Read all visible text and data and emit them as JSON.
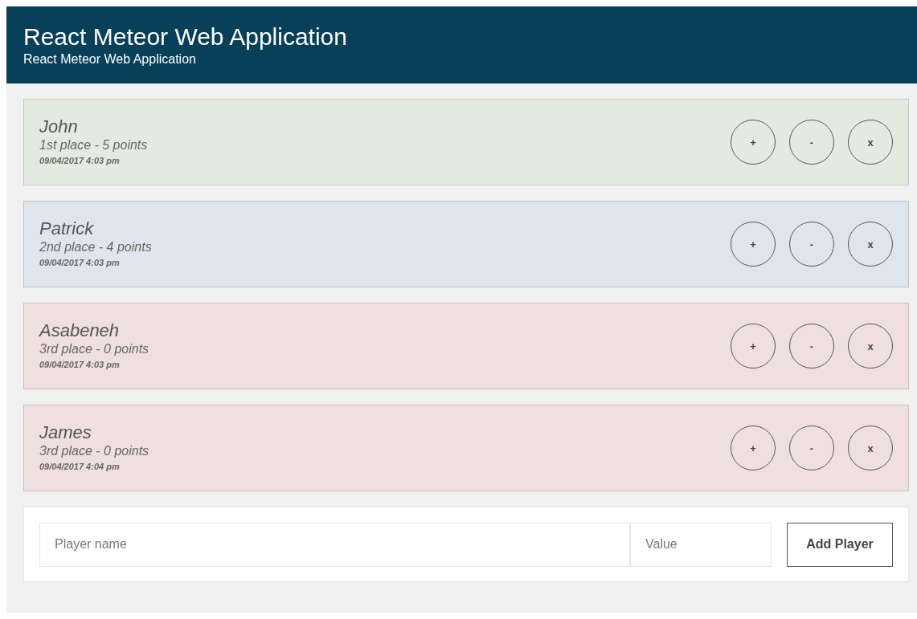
{
  "header": {
    "title": "React Meteor Web Application",
    "subtitle": "React Meteor Web Application"
  },
  "players": [
    {
      "name": "John",
      "rank": "1st place - 5 points",
      "time": "09/04/2017 4:03 pm",
      "color": "#e3ebe0",
      "buttons": [
        "+",
        "-",
        "x"
      ]
    },
    {
      "name": "Patrick",
      "rank": "2nd place - 4 points",
      "time": "09/04/2017 4:03 pm",
      "color": "#dfe5ec",
      "buttons": [
        "+",
        "-",
        "x"
      ]
    },
    {
      "name": "Asabeneh",
      "rank": "3rd place - 0 points",
      "time": "09/04/2017 4:03 pm",
      "color": "#efdfe0",
      "buttons": [
        "+",
        "-",
        "x"
      ]
    },
    {
      "name": "James",
      "rank": "3rd place - 0 points",
      "time": "09/04/2017 4:04 pm",
      "color": "#efdfe0",
      "buttons": [
        "+",
        "-",
        "x"
      ]
    }
  ],
  "form": {
    "name_field": {
      "placeholder": "Player name"
    },
    "value_field": {
      "placeholder": "Value"
    },
    "button": "Add Player"
  }
}
